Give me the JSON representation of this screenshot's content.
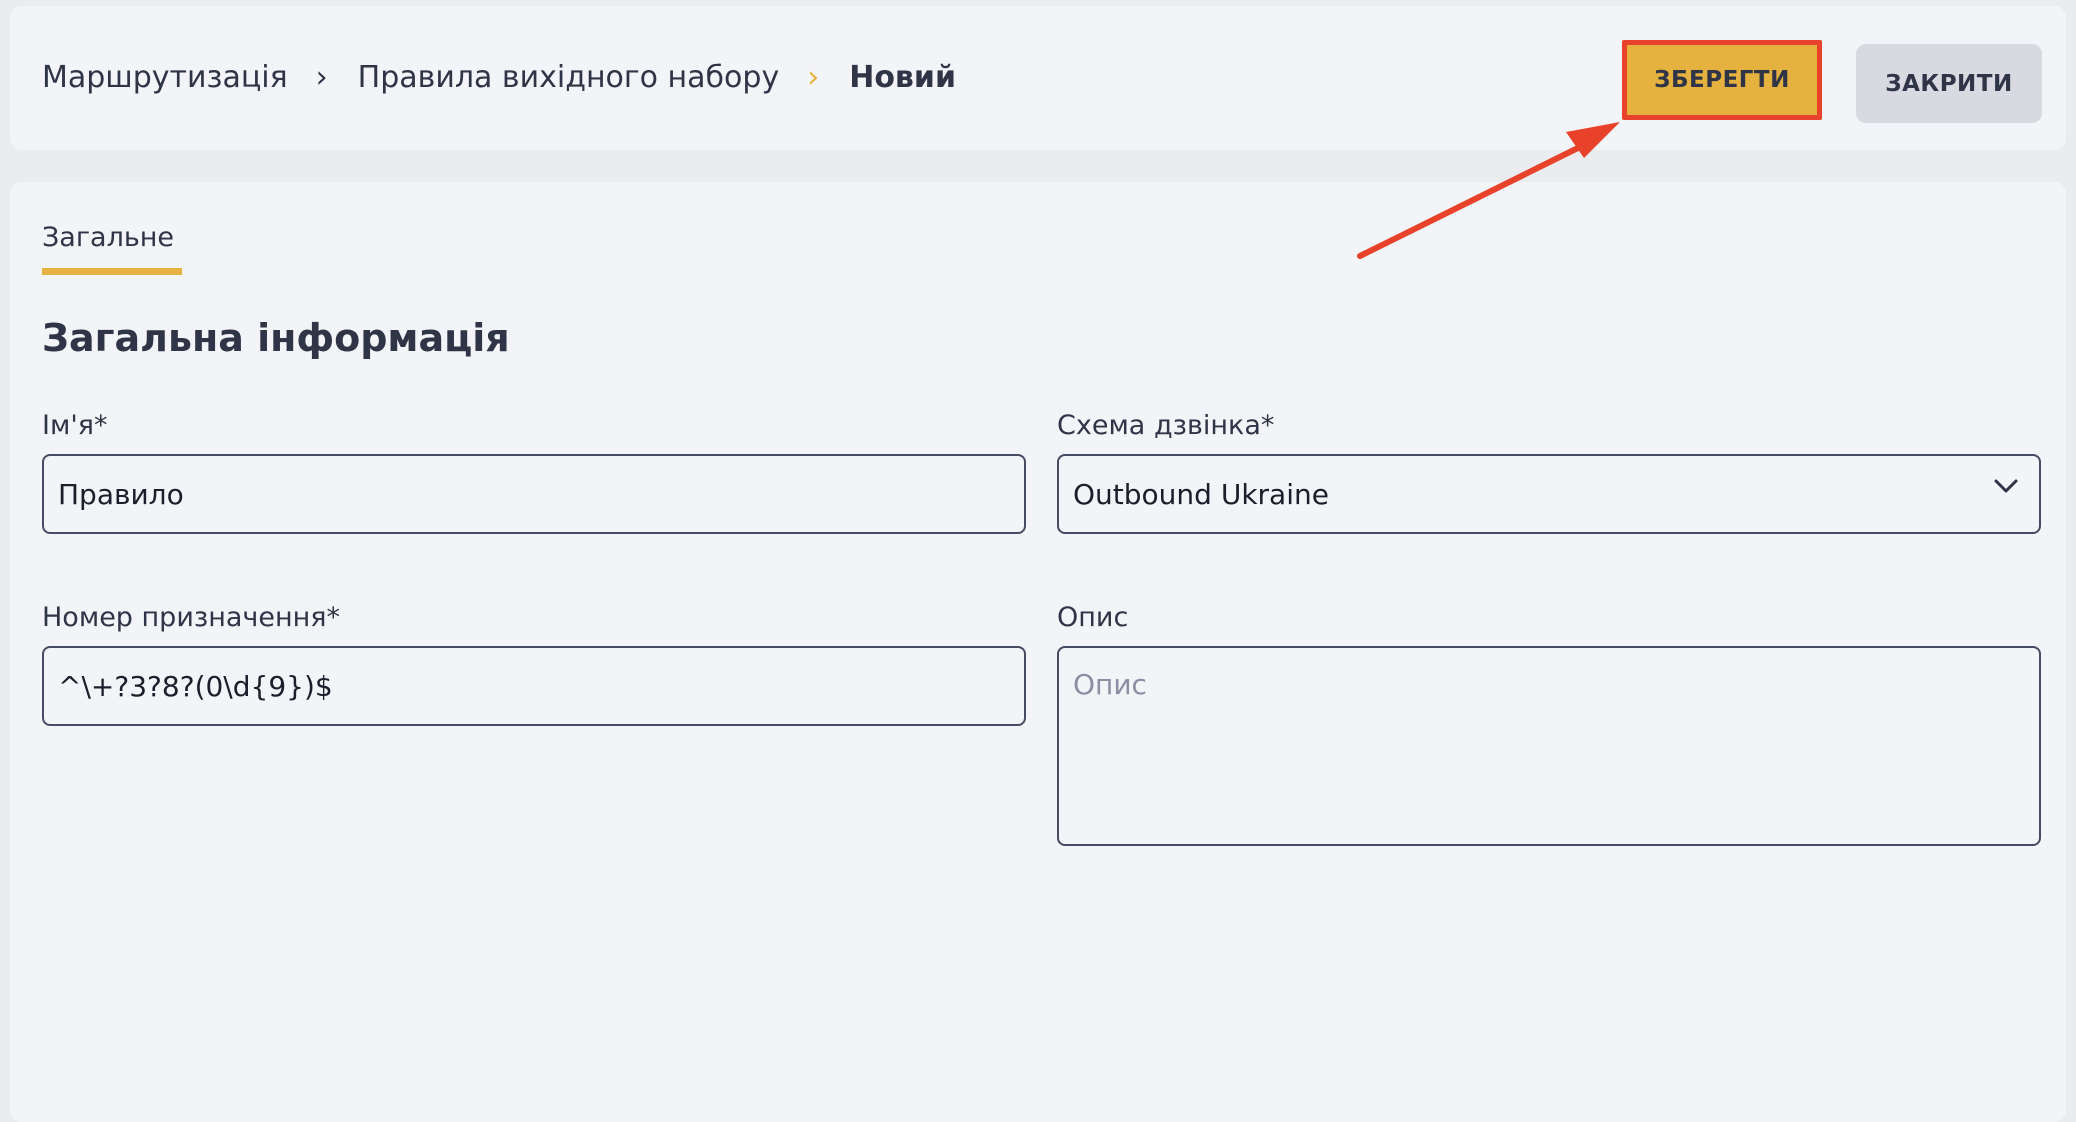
{
  "breadcrumb": {
    "items": [
      "Маршрутизація",
      "Правила вихідного набору"
    ],
    "current": "Новий",
    "separator": "›"
  },
  "toolbar": {
    "save_label": "ЗБЕРЕГТИ",
    "close_label": "ЗАКРИТИ"
  },
  "tabs": [
    {
      "label": "Загальне",
      "active": true
    }
  ],
  "section": {
    "title": "Загальна інформація"
  },
  "form": {
    "name": {
      "label": "Ім'я*",
      "value": "Правило"
    },
    "call_scheme": {
      "label": "Схема дзвінка*",
      "value": "Outbound Ukraine"
    },
    "destination": {
      "label": "Номер призначення*",
      "value": "^\\+?3?8?(0\\d{9})$"
    },
    "description": {
      "label": "Опис",
      "value": "",
      "placeholder": "Опис"
    }
  },
  "colors": {
    "accent": "#e5b13f",
    "highlight_border": "#e8432a",
    "arrow": "#e8432a",
    "text": "#2f3447",
    "panel": "#f3f4f7",
    "background": "#ebecf0"
  },
  "icons": {
    "breadcrumb_separator": "chevron-right-icon",
    "select_toggle": "chevron-down-icon",
    "annotation": "arrow-annotation"
  }
}
